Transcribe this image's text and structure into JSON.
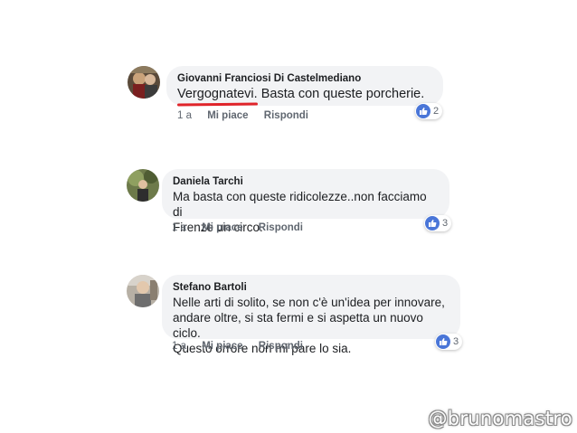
{
  "comments": [
    {
      "author": "Giovanni Franciosi Di Castelmediano",
      "text_underlined": "Vergognatevi.",
      "text_rest": " Basta con queste porcherie.",
      "time": "1 a",
      "like": "Mi piace",
      "reply": "Rispondi",
      "reaction_count": "2"
    },
    {
      "author": "Daniela Tarchi",
      "lines": [
        "Ma basta con queste ridicolezze..non facciamo di",
        "Firenze un circo."
      ],
      "time": "1 a",
      "like": "Mi piace",
      "reply": "Rispondi",
      "reaction_count": "3"
    },
    {
      "author": "Stefano Bartoli",
      "lines": [
        "Nelle arti di solito, se non c'è un'idea per innovare,",
        "andare oltre, si sta fermi e si aspetta un nuovo ciclo.",
        "Questo orrore non mi pare lo sia."
      ],
      "time": "1 a",
      "like": "Mi piace",
      "reply": "Rispondi",
      "reaction_count": "3"
    }
  ],
  "watermark": "@brunomastro",
  "colors": {
    "like_blue": "#4a76d8",
    "bubble": "#f2f3f5",
    "underline_red": "#e0242a"
  },
  "icons": [
    "like-icon"
  ]
}
